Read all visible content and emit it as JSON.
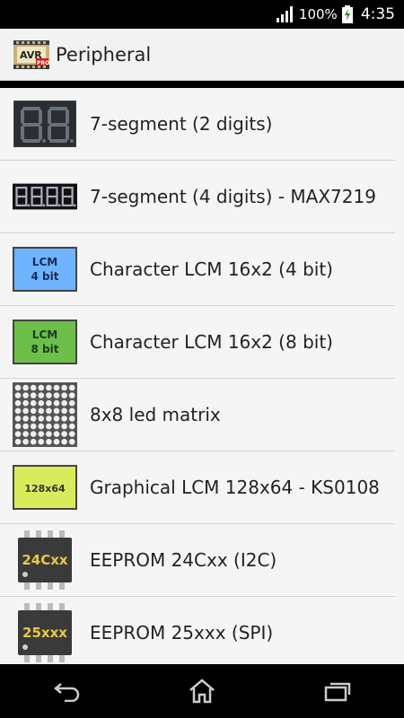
{
  "status_bar": {
    "battery": "100%",
    "time": "4:35",
    "icons": [
      "signal-icon",
      "battery-charging-icon"
    ]
  },
  "action_bar": {
    "app_icon_text": "AVR",
    "app_icon_badge": "PRO",
    "title": "Peripheral"
  },
  "list": {
    "items": [
      {
        "label": "7-segment (2 digits)",
        "icon": "seven-segment-2-digit-icon"
      },
      {
        "label": "7-segment (4 digits) - MAX7219",
        "icon": "seven-segment-4-digit-icon"
      },
      {
        "label": "Character LCM 16x2 (4 bit)",
        "icon": "lcm-4bit-icon",
        "icon_text": [
          "LCM",
          "4 bit"
        ]
      },
      {
        "label": "Character LCM 16x2 (8 bit)",
        "icon": "lcm-8bit-icon",
        "icon_text": [
          "LCM",
          "8 bit"
        ]
      },
      {
        "label": "8x8 led matrix",
        "icon": "led-matrix-icon"
      },
      {
        "label": "Graphical LCM 128x64 - KS0108",
        "icon": "glcd-icon",
        "icon_text": [
          "128x64"
        ]
      },
      {
        "label": "EEPROM 24Cxx (I2C)",
        "icon": "eeprom-24cxx-chip-icon",
        "icon_text": [
          "24Cxx"
        ]
      },
      {
        "label": "EEPROM 25xxx (SPI)",
        "icon": "eeprom-25xxx-chip-icon",
        "icon_text": [
          "25xxx"
        ]
      }
    ]
  },
  "nav_bar": {
    "buttons": [
      "back-icon",
      "home-icon",
      "recent-apps-icon"
    ]
  },
  "colors": {
    "lcm_blue": "#6eb4ff",
    "lcm_green": "#6cc04a",
    "glcd_yellow": "#d8ec5a",
    "segment_bg": "#2a2e33"
  }
}
